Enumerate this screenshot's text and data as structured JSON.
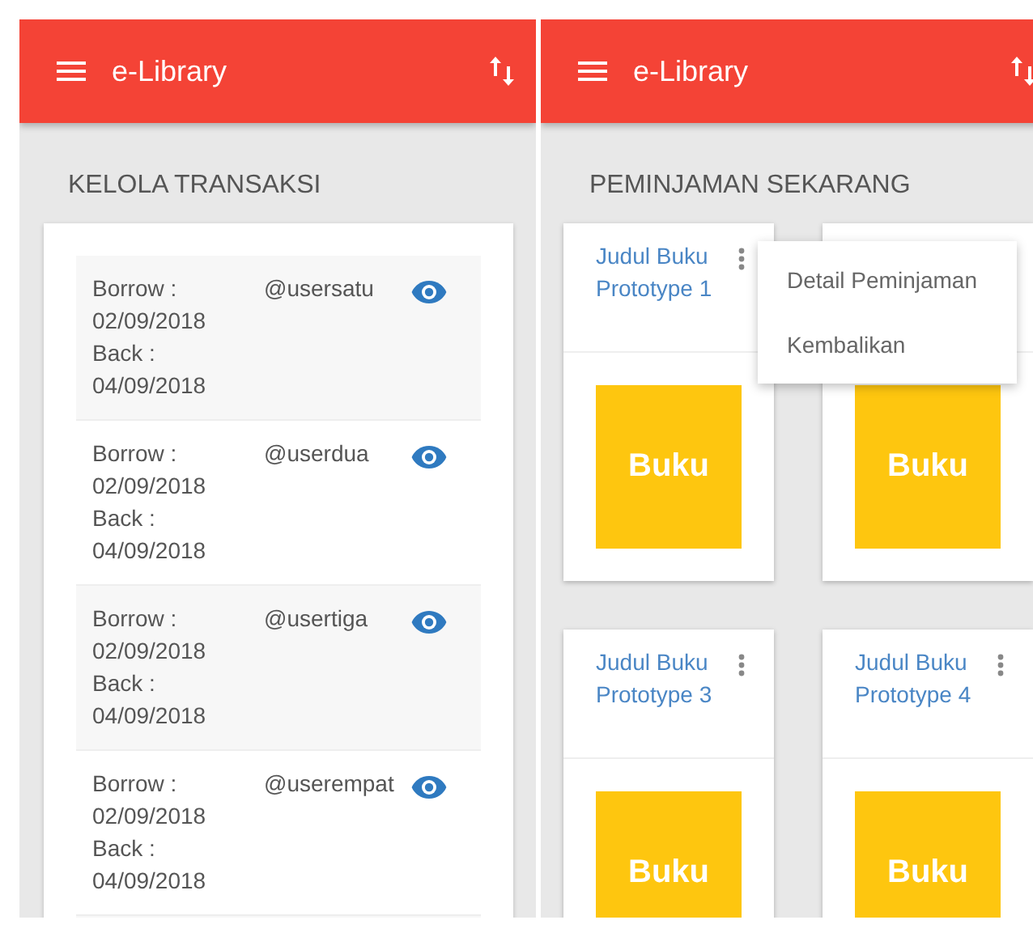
{
  "left_screen": {
    "app_bar": {
      "title": "e-Library"
    },
    "heading": "KELOLA TRANSAKSI",
    "transactions": [
      {
        "borrow_label": "Borrow :",
        "borrow_date": "02/09/2018",
        "back_label": "Back :",
        "back_date": "04/09/2018",
        "user": "@usersatu"
      },
      {
        "borrow_label": "Borrow :",
        "borrow_date": "02/09/2018",
        "back_label": "Back :",
        "back_date": "04/09/2018",
        "user": "@userdua"
      },
      {
        "borrow_label": "Borrow :",
        "borrow_date": "02/09/2018",
        "back_label": "Back :",
        "back_date": "04/09/2018",
        "user": "@usertiga"
      },
      {
        "borrow_label": "Borrow :",
        "borrow_date": "02/09/2018",
        "back_label": "Back :",
        "back_date": "04/09/2018",
        "user": "@userempat"
      }
    ]
  },
  "right_screen": {
    "app_bar": {
      "title": "e-Library"
    },
    "heading": "PEMINJAMAN SEKARANG",
    "books": [
      {
        "title": "Judul Buku Prototype 1",
        "cover": "Buku"
      },
      {
        "cover": "Buku"
      },
      {
        "title": "Judul Buku Prototype 3",
        "cover": "Buku"
      },
      {
        "title": "Judul Buku Prototype 4",
        "cover": "Buku"
      }
    ],
    "menu": {
      "items": [
        "Detail Peminjaman",
        "Kembalikan"
      ]
    }
  }
}
